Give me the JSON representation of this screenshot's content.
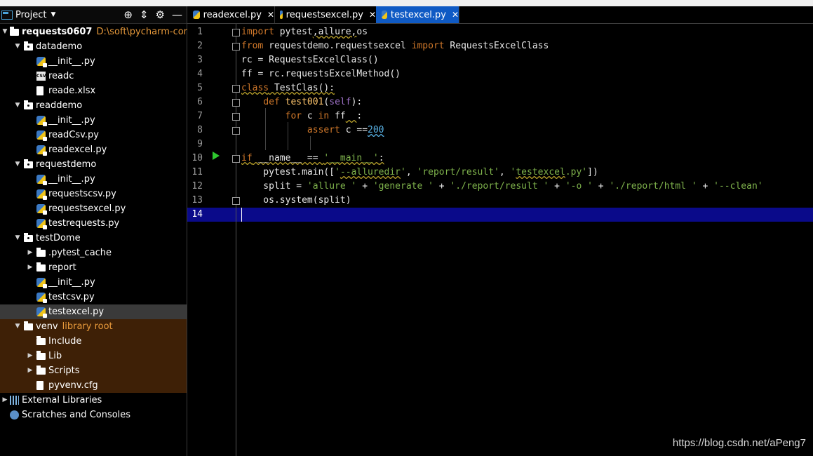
{
  "sidebar": {
    "title": "Project",
    "rows": [
      {
        "label": "requests0607",
        "sub": "D:\\soft\\pycharm-commun",
        "indent": 0,
        "arrow": "▼",
        "icon": "folder"
      },
      {
        "label": "datademo",
        "sub": "",
        "indent": 1,
        "arrow": "▼",
        "icon": "folder-dot"
      },
      {
        "label": "__init__.py",
        "sub": "",
        "indent": 2,
        "arrow": "",
        "icon": "py"
      },
      {
        "label": "readc",
        "sub": "",
        "indent": 2,
        "arrow": "",
        "icon": "csv"
      },
      {
        "label": "reade.xlsx",
        "sub": "",
        "indent": 2,
        "arrow": "",
        "icon": "file"
      },
      {
        "label": "readdemo",
        "sub": "",
        "indent": 1,
        "arrow": "▼",
        "icon": "folder-dot"
      },
      {
        "label": "__init__.py",
        "sub": "",
        "indent": 2,
        "arrow": "",
        "icon": "py"
      },
      {
        "label": "readCsv.py",
        "sub": "",
        "indent": 2,
        "arrow": "",
        "icon": "py"
      },
      {
        "label": "readexcel.py",
        "sub": "",
        "indent": 2,
        "arrow": "",
        "icon": "py"
      },
      {
        "label": "requestdemo",
        "sub": "",
        "indent": 1,
        "arrow": "▼",
        "icon": "folder-dot"
      },
      {
        "label": "__init__.py",
        "sub": "",
        "indent": 2,
        "arrow": "",
        "icon": "py"
      },
      {
        "label": "requestscsv.py",
        "sub": "",
        "indent": 2,
        "arrow": "",
        "icon": "py"
      },
      {
        "label": "requestsexcel.py",
        "sub": "",
        "indent": 2,
        "arrow": "",
        "icon": "py"
      },
      {
        "label": "testrequests.py",
        "sub": "",
        "indent": 2,
        "arrow": "",
        "icon": "py"
      },
      {
        "label": "testDome",
        "sub": "",
        "indent": 1,
        "arrow": "▼",
        "icon": "folder-dot"
      },
      {
        "label": ".pytest_cache",
        "sub": "",
        "indent": 2,
        "arrow": "▶",
        "icon": "folder"
      },
      {
        "label": "report",
        "sub": "",
        "indent": 2,
        "arrow": "▶",
        "icon": "folder"
      },
      {
        "label": "__init__.py",
        "sub": "",
        "indent": 2,
        "arrow": "",
        "icon": "py"
      },
      {
        "label": "testcsv.py",
        "sub": "",
        "indent": 2,
        "arrow": "",
        "icon": "py"
      },
      {
        "label": "testexcel.py",
        "sub": "",
        "indent": 2,
        "arrow": "",
        "icon": "py",
        "selected": true
      },
      {
        "label": "venv",
        "sub": "library root",
        "indent": 1,
        "arrow": "▼",
        "icon": "folder",
        "lib": true
      },
      {
        "label": "Include",
        "sub": "",
        "indent": 2,
        "arrow": "",
        "icon": "folder",
        "lib": true
      },
      {
        "label": "Lib",
        "sub": "",
        "indent": 2,
        "arrow": "▶",
        "icon": "folder",
        "lib": true
      },
      {
        "label": "Scripts",
        "sub": "",
        "indent": 2,
        "arrow": "▶",
        "icon": "folder",
        "lib": true
      },
      {
        "label": "pyvenv.cfg",
        "sub": "",
        "indent": 2,
        "arrow": "",
        "icon": "file",
        "lib": true
      },
      {
        "label": "External Libraries",
        "sub": "",
        "indent": 0,
        "arrow": "▶",
        "icon": "libs"
      },
      {
        "label": "Scratches and Consoles",
        "sub": "",
        "indent": 0,
        "arrow": "",
        "icon": "scratch"
      }
    ]
  },
  "tabs": [
    {
      "label": "readexcel.py",
      "active": false
    },
    {
      "label": "requestsexcel.py",
      "active": false
    },
    {
      "label": "testexcel.py",
      "active": true
    }
  ],
  "editor": {
    "current_line": 14,
    "lines": [
      "1",
      "2",
      "3",
      "4",
      "5",
      "6",
      "7",
      "8",
      "9",
      "10",
      "11",
      "12",
      "13",
      "14"
    ]
  },
  "watermark": "https://blog.csdn.net/aPeng7"
}
